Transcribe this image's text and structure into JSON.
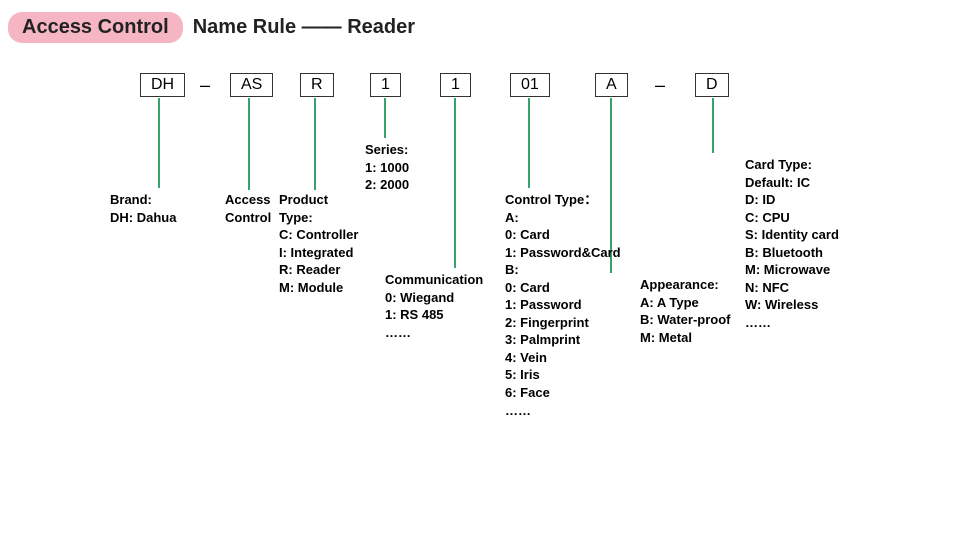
{
  "title": {
    "pill": "Access Control",
    "rest": "Name Rule —— Reader"
  },
  "seps": {
    "dash": "–"
  },
  "codes": {
    "c1": "DH",
    "c2": "AS",
    "c3": "R",
    "c4": "1",
    "c5": "1",
    "c6": "01",
    "c7": "A",
    "c8": "D"
  },
  "desc": {
    "brand": "Brand:\nDH: Dahua",
    "access": "Access\nControl",
    "ptype": "Product\nType:\nC: Controller\nI: Integrated\nR: Reader\nM: Module",
    "series": "Series:\n1: 1000\n2: 2000",
    "comm": "Communication\n0: Wiegand\n1: RS 485\n……",
    "ctrl": "Control Type：\nA:\n0: Card\n1: Password&Card\nB:\n0: Card\n1: Password\n2: Fingerprint\n3: Palmprint\n4: Vein\n5: Iris\n6: Face\n……",
    "appear": "Appearance:\nA: A Type\nB: Water-proof\nM: Metal",
    "card": "Card Type:\nDefault: IC\nD: ID\nC: CPU\nS: Identity card\nB: Bluetooth\nM: Microwave\nN: NFC\nW: Wireless\n……"
  }
}
